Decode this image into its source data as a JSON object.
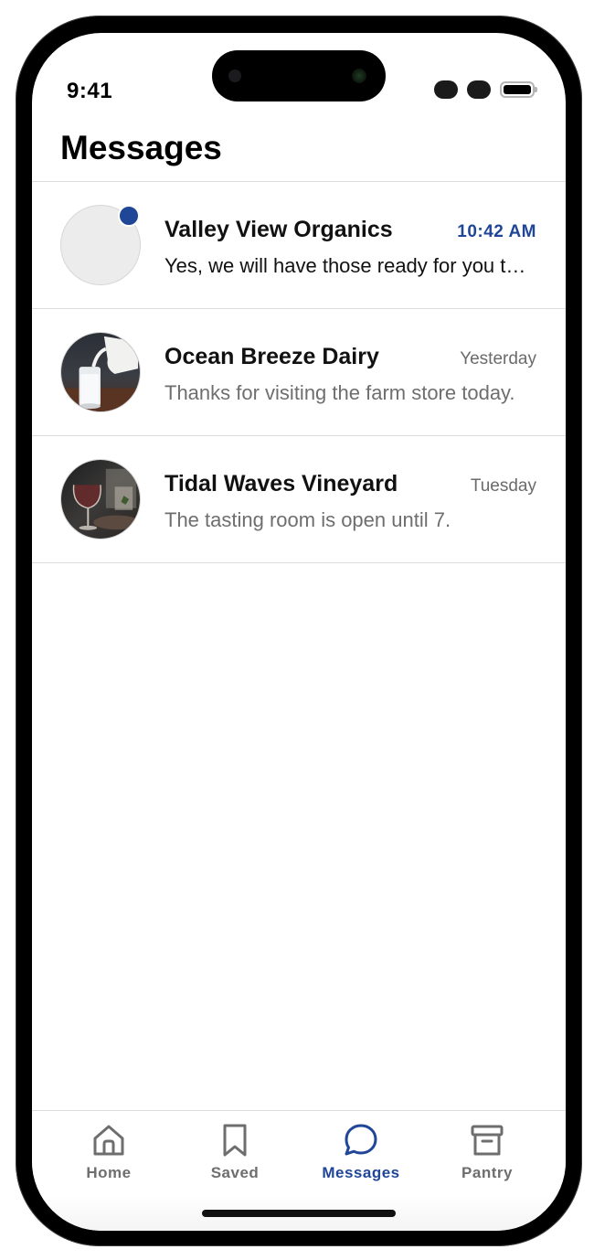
{
  "status_bar": {
    "time": "9:41"
  },
  "header": {
    "title": "Messages"
  },
  "conversations": [
    {
      "name": "Valley View Organics",
      "time": "10:42 AM",
      "preview": "Yes, we will have those ready for you tomorrow morning.",
      "unread": true,
      "avatar": "placeholder"
    },
    {
      "name": "Ocean Breeze Dairy",
      "time": "Yesterday",
      "preview": "Thanks for visiting the farm store today.",
      "unread": false,
      "avatar": "milk-pour-photo"
    },
    {
      "name": "Tidal Waves Vineyard",
      "time": "Tuesday",
      "preview": "The tasting room is open until 7.",
      "unread": false,
      "avatar": "wine-glass-photo"
    }
  ],
  "tab_bar": {
    "tabs": [
      {
        "label": "Home",
        "icon": "home-icon",
        "active": false
      },
      {
        "label": "Saved",
        "icon": "bookmark-icon",
        "active": false
      },
      {
        "label": "Messages",
        "icon": "chat-bubble-icon",
        "active": true
      },
      {
        "label": "Pantry",
        "icon": "archive-box-icon",
        "active": false
      }
    ]
  },
  "colors": {
    "accent": "#1f4697",
    "secondary_text": "#6e6e6e",
    "divider": "#dcdcdc"
  }
}
